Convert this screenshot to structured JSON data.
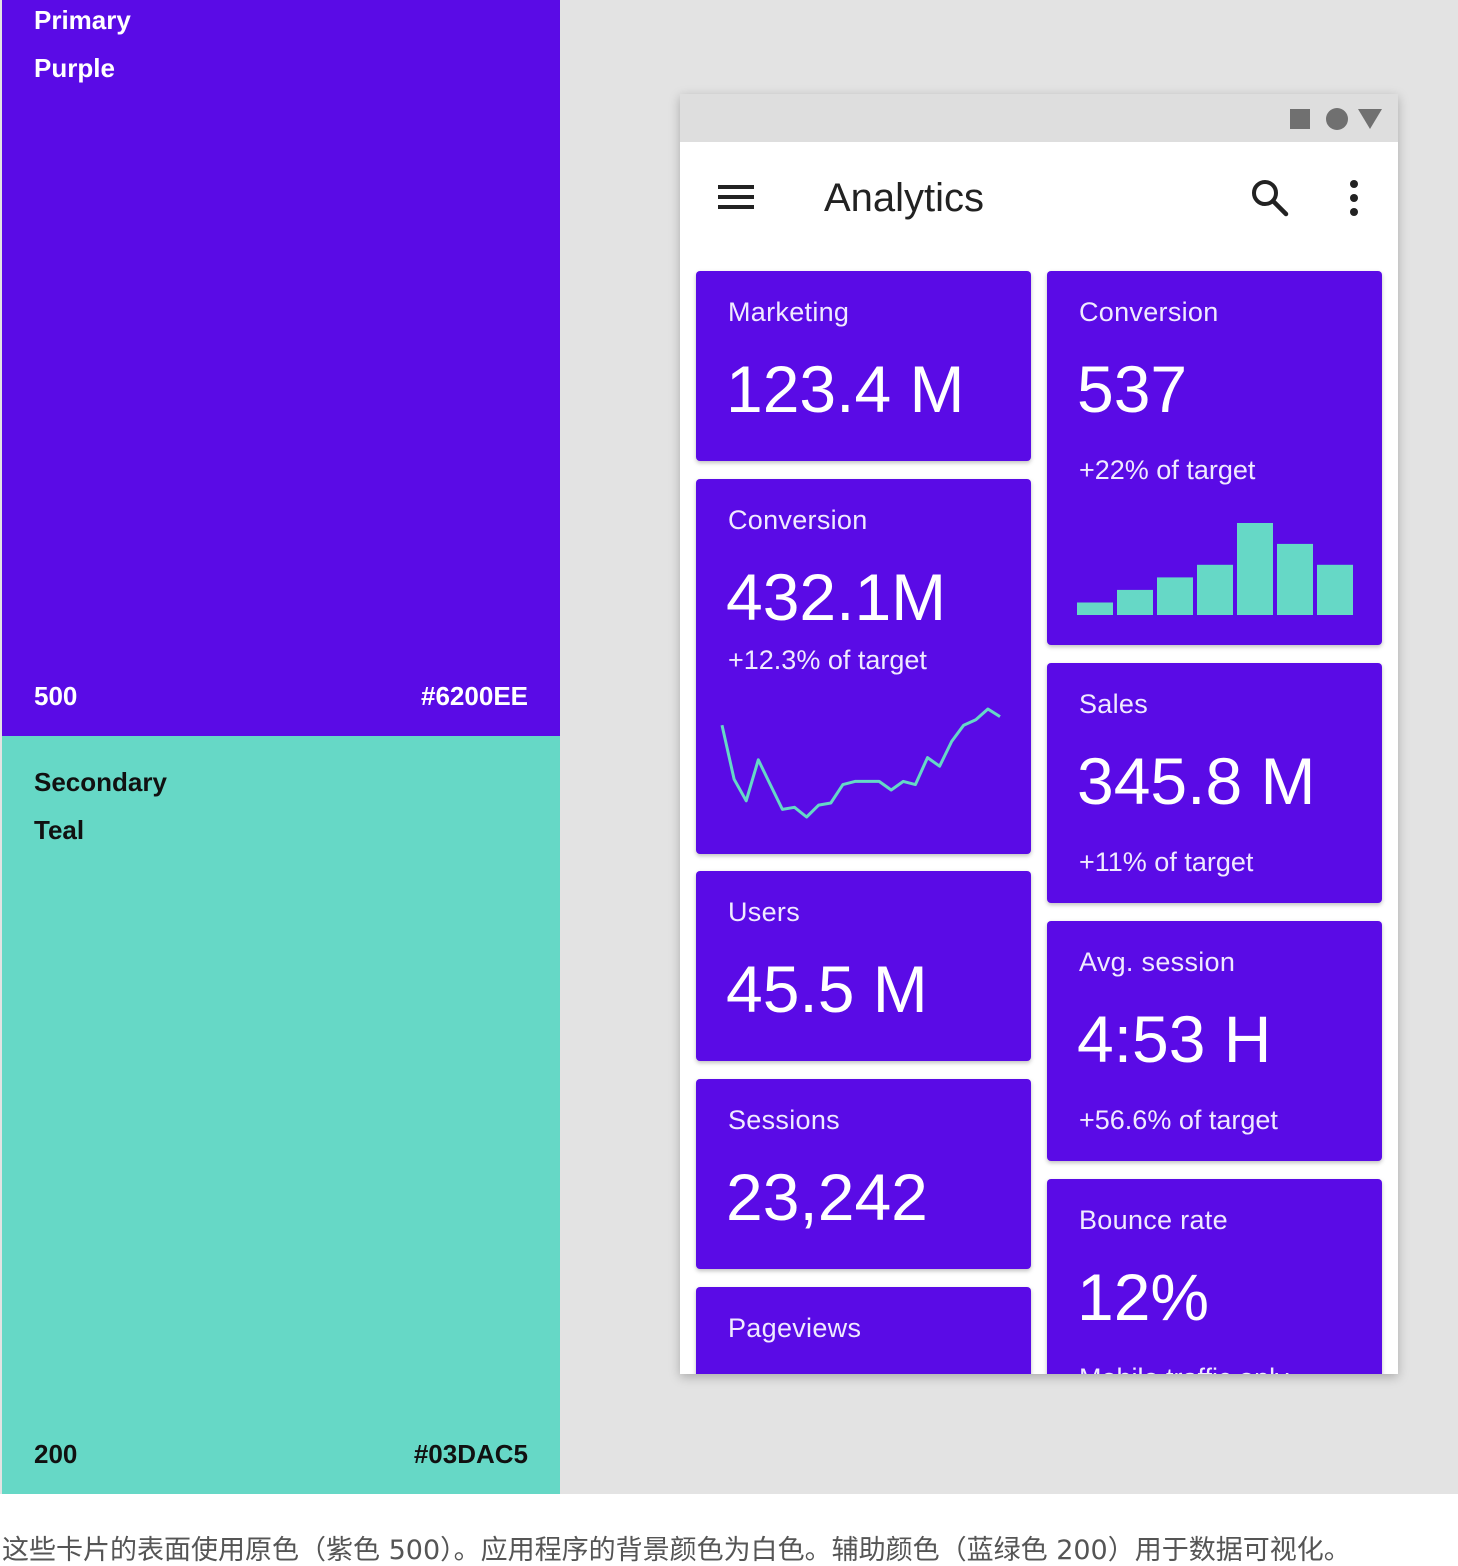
{
  "swatches": {
    "primary": {
      "label": "Primary",
      "name": "Purple",
      "shade": "500",
      "hex": "#6200EE",
      "color": "#5a0be6"
    },
    "secondary": {
      "label": "Secondary",
      "name": "Teal",
      "shade": "200",
      "hex": "#03DAC5",
      "color": "#66d8c6"
    }
  },
  "phone": {
    "status_icons": [
      "square-icon",
      "circle-icon",
      "triangle-icon"
    ],
    "appbar": {
      "title": "Analytics",
      "icons": [
        "menu-icon",
        "search-icon",
        "more-vert-icon"
      ]
    },
    "cards": {
      "marketing": {
        "label": "Marketing",
        "value": "123.4 M"
      },
      "conversion_left": {
        "label": "Conversion",
        "value": "432.1M",
        "sub": "+12.3% of target"
      },
      "users": {
        "label": "Users",
        "value": "45.5 M"
      },
      "sessions": {
        "label": "Sessions",
        "value": "23,242"
      },
      "pageviews": {
        "label": "Pageviews"
      },
      "conversion_right": {
        "label": "Conversion",
        "value": "537",
        "sub": "+22% of target"
      },
      "sales": {
        "label": "Sales",
        "value": "345.8 M",
        "sub": "+11% of target"
      },
      "avg_session": {
        "label": "Avg. session",
        "value": "4:53 H",
        "sub": "+56.6% of target"
      },
      "bounce_rate": {
        "label": "Bounce rate",
        "value": "12%",
        "sub": "Mobile traffic only"
      }
    },
    "card_color": "#5a0be6",
    "viz_color": "#66d8c6"
  },
  "chart_data": [
    {
      "type": "bar",
      "categories": [
        "1",
        "2",
        "3",
        "4",
        "5",
        "6",
        "7"
      ],
      "values": [
        12,
        24,
        36,
        48,
        88,
        68,
        48
      ]
    },
    {
      "type": "line",
      "x": [
        0,
        1,
        2,
        3,
        4,
        5,
        6,
        7,
        8,
        9,
        10,
        11,
        12,
        13,
        14,
        15,
        16,
        17,
        18,
        19,
        20,
        21,
        22,
        23
      ],
      "values": [
        90,
        40,
        20,
        58,
        35,
        12,
        14,
        5,
        16,
        18,
        35,
        38,
        38,
        38,
        30,
        38,
        35,
        60,
        52,
        75,
        90,
        95,
        105,
        98
      ]
    }
  ],
  "caption": "这些卡片的表面使用原色（紫色 500）。应用程序的背景颜色为白色。辅助颜色（蓝绿色 200）用于数据可视化。"
}
